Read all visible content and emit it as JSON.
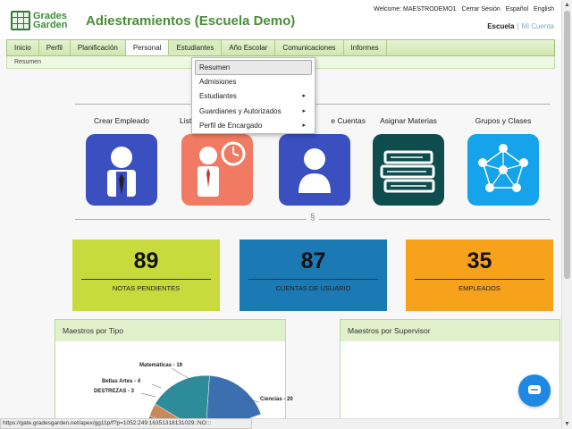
{
  "header": {
    "logo_text_1": "Grades",
    "logo_text_2": "Garden",
    "title": "Adiestramientos (Escuela Demo)",
    "welcome": "Welcome: MAESTRODEMO1",
    "logout": "Cerrar Sesión",
    "lang_es": "Español",
    "lang_en": "English",
    "school_link": "Escuela",
    "separator": "|",
    "account_link": "Mi Cuenta"
  },
  "nav": {
    "items": [
      "Inicio",
      "Perfil",
      "Planificación",
      "Personal",
      "Estudiantes",
      "Año Escolar",
      "Comunicaciones",
      "Informes"
    ],
    "active": "Personal",
    "subnav": "Resumen"
  },
  "dropdown": {
    "items": [
      {
        "label": "Resumen",
        "submenu": false
      },
      {
        "label": "Admisiones",
        "submenu": false
      },
      {
        "label": "Estudiantes",
        "submenu": true
      },
      {
        "label": "Guardianes y Autorizados",
        "submenu": true
      },
      {
        "label": "Perfil de Encargado",
        "submenu": true
      }
    ],
    "arrow": "▸"
  },
  "cards": [
    {
      "label": "Crear Empleado",
      "icon": "employee-icon",
      "color": "#3a4fc0"
    },
    {
      "label": "List",
      "icon": "clock-employee-icon",
      "color": "#f07a62"
    },
    {
      "label": "e Cuentas",
      "icon": "user-account-icon",
      "color": "#3a4fc0"
    },
    {
      "label": "Asignar Materias",
      "icon": "books-icon",
      "color": "#0e4d4d"
    },
    {
      "label": "Grupos y Clases",
      "icon": "group-network-icon",
      "color": "#15a3ec"
    }
  ],
  "section_mark": "§",
  "stats": [
    {
      "value": "89",
      "label": "NOTAS PENDIENTES",
      "color": "#c8da3c"
    },
    {
      "value": "87",
      "label": "CUENTAS DE USUARIO",
      "color": "#1b7ab3"
    },
    {
      "value": "35",
      "label": "EMPLEADOS",
      "color": "#f7a21b"
    }
  ],
  "panels": {
    "left_title": "Maestros por Tipo",
    "right_title": "Maestros por Supervisor"
  },
  "chart_data": {
    "type": "pie",
    "title": "",
    "visible_slices": [
      {
        "label": "Matemáticas",
        "value": 19,
        "text": "Matemáticas - 19",
        "color": "#2e8b9a"
      },
      {
        "label": "Bellas Artes",
        "value": 4,
        "text": "Bellas Artes - 4",
        "color": "#c9885a"
      },
      {
        "label": "DESTREZAS",
        "value": 3,
        "text": "DESTREZAS - 3",
        "color": "#6e5a8a"
      },
      {
        "label": "Ciencias",
        "value": 20,
        "text": "Ciencias - 20",
        "color": "#3c6fb0"
      }
    ]
  },
  "status_bar": "https://gate.gradesgarden.net/apex/gg11p/f?p=1052:249:16351318131029::NO:::",
  "colors": {
    "brand_green": "#4a8d3a",
    "chat_button": "#1e88e5"
  }
}
